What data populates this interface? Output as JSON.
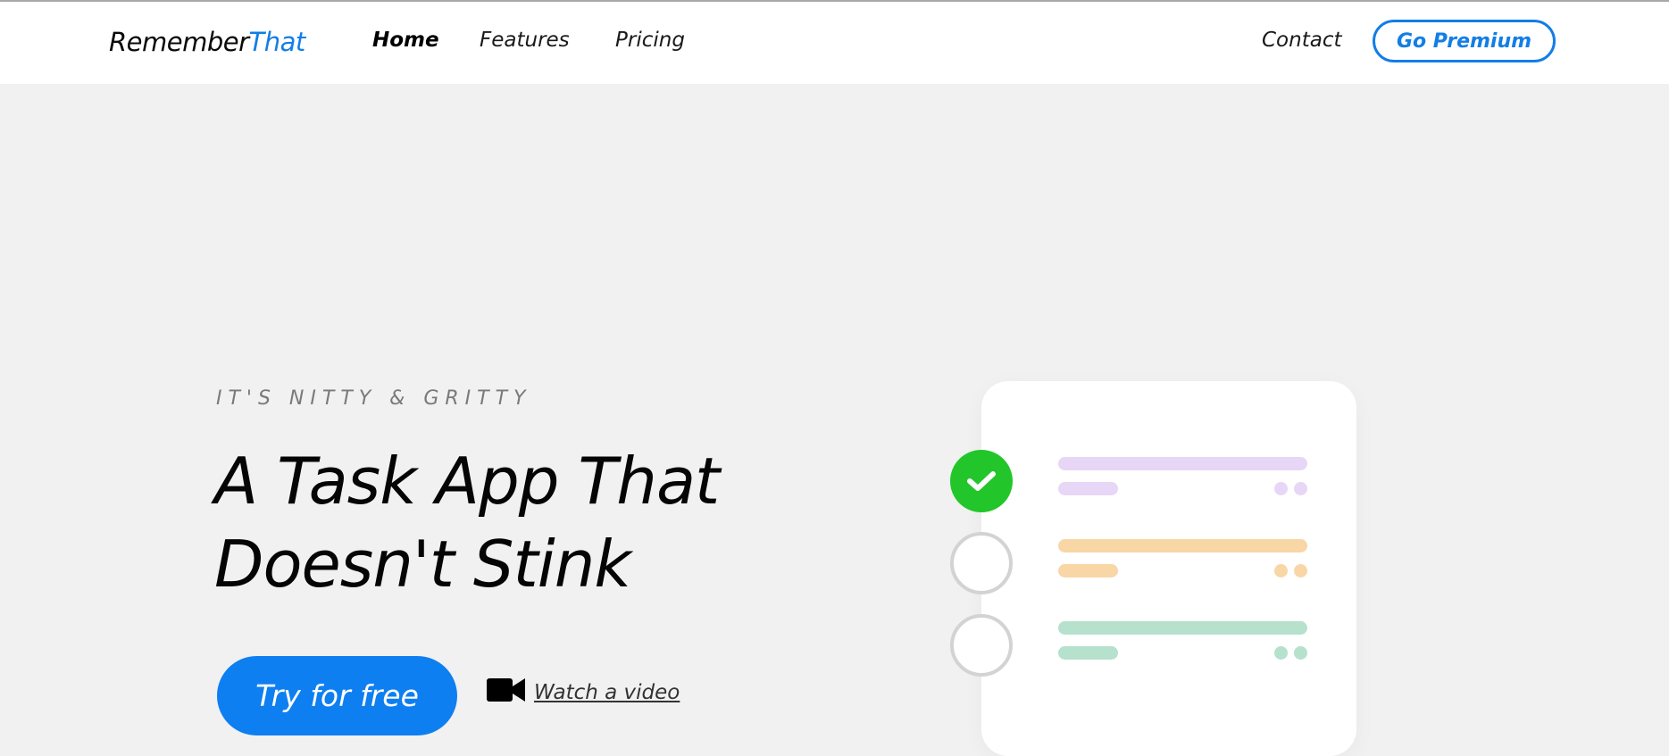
{
  "brand": {
    "name_part1": "Remember",
    "name_part2": "That",
    "accent_color": "#127ee6"
  },
  "nav": {
    "home": "Home",
    "features": "Features",
    "pricing": "Pricing",
    "contact": "Contact",
    "premium_button": "Go Premium"
  },
  "hero": {
    "eyebrow": "IT'S NITTY & GRITTY",
    "headline": "A Task App That Doesn't Stink",
    "cta_button": "Try for free",
    "video_icon": "video-camera-icon",
    "video_link": "Watch a video"
  },
  "illustration": {
    "tasks": [
      {
        "status": "done",
        "color": "#e8d6f6"
      },
      {
        "status": "todo",
        "color": "#f8d6a6"
      },
      {
        "status": "todo",
        "color": "#b5e1cd"
      }
    ],
    "check_color": "#22c62a"
  }
}
